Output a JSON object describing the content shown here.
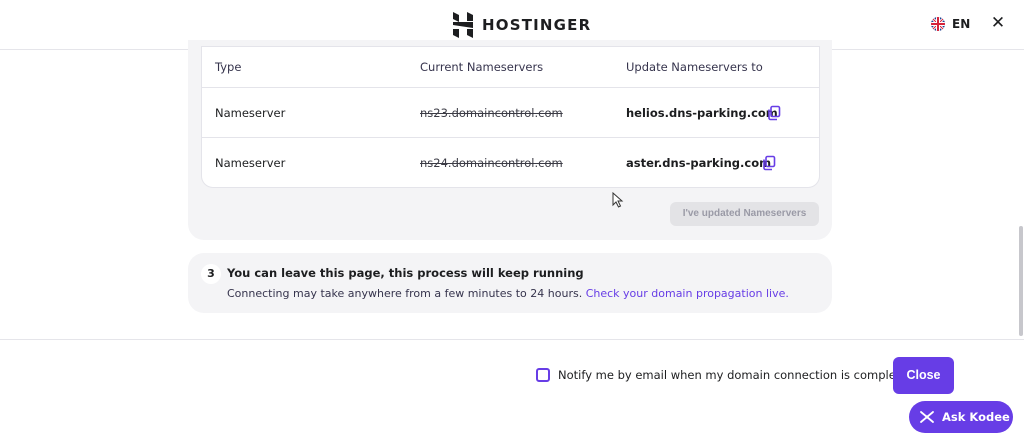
{
  "header": {
    "brand": "HOSTINGER",
    "language": "EN",
    "close_symbol": "✕",
    "icons": {
      "logo": "hostinger-logo",
      "flag": "uk-flag-icon",
      "close": "close-icon"
    }
  },
  "nameservers": {
    "columns": [
      "Type",
      "Current Nameservers",
      "Update Nameservers to"
    ],
    "rows": [
      {
        "type": "Nameserver",
        "current": "ns23.domaincontrol.com",
        "update": "helios.dns-parking.com"
      },
      {
        "type": "Nameserver",
        "current": "ns24.domaincontrol.com",
        "update": "aster.dns-parking.com"
      }
    ],
    "updated_button": "I've updated Nameservers"
  },
  "step3": {
    "number": "3",
    "title": "You can leave this page, this process will keep running",
    "description": "Connecting may take anywhere from a few minutes to 24 hours.",
    "link": "Check your domain propagation live."
  },
  "footer": {
    "notify_label": "Notify me by email when my domain connection is complete",
    "notify_checked": false,
    "close_button": "Close",
    "kodee_button": "Ask Kodee"
  },
  "colors": {
    "accent": "#673de6",
    "card_bg": "#f4f4f6",
    "border": "#e4e4ea",
    "disabled_bg": "#e3e3e6"
  }
}
